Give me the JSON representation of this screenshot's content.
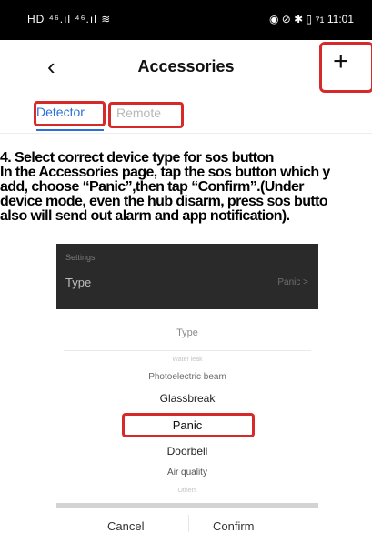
{
  "status_bar": {
    "left_icons": "HD ⁴⁶.ıl ⁴⁶.ıl ≋",
    "right_icons": "◉ ⊘ ✱ ▯",
    "battery": "71",
    "time": "11:01"
  },
  "header": {
    "back_glyph": "‹",
    "title": "Accessories",
    "add_glyph": "+"
  },
  "tabs": [
    {
      "label": "Detector"
    },
    {
      "label": "Remote"
    }
  ],
  "instructions": "4. Select correct device type for sos button\nIn the Accessories page, tap the sos button which y\nadd, choose “Panic”,then tap “Confirm”.(Under\ndevice mode, even the hub disarm, press sos butto\nalso will send out alarm and app notification).",
  "settings_panel": {
    "section": "Settings",
    "row_label": "Type",
    "row_value": "Panic"
  },
  "picker": {
    "title": "Type",
    "options": [
      "Water leak",
      "Photoelectric beam",
      "Glassbreak",
      "Panic",
      "Doorbell",
      "Air quality",
      "Others"
    ],
    "selected": "Panic",
    "cancel_label": "Cancel",
    "confirm_label": "Confirm"
  },
  "accent_color": "#d62a2a",
  "tab_active_color": "#2b6fd8"
}
